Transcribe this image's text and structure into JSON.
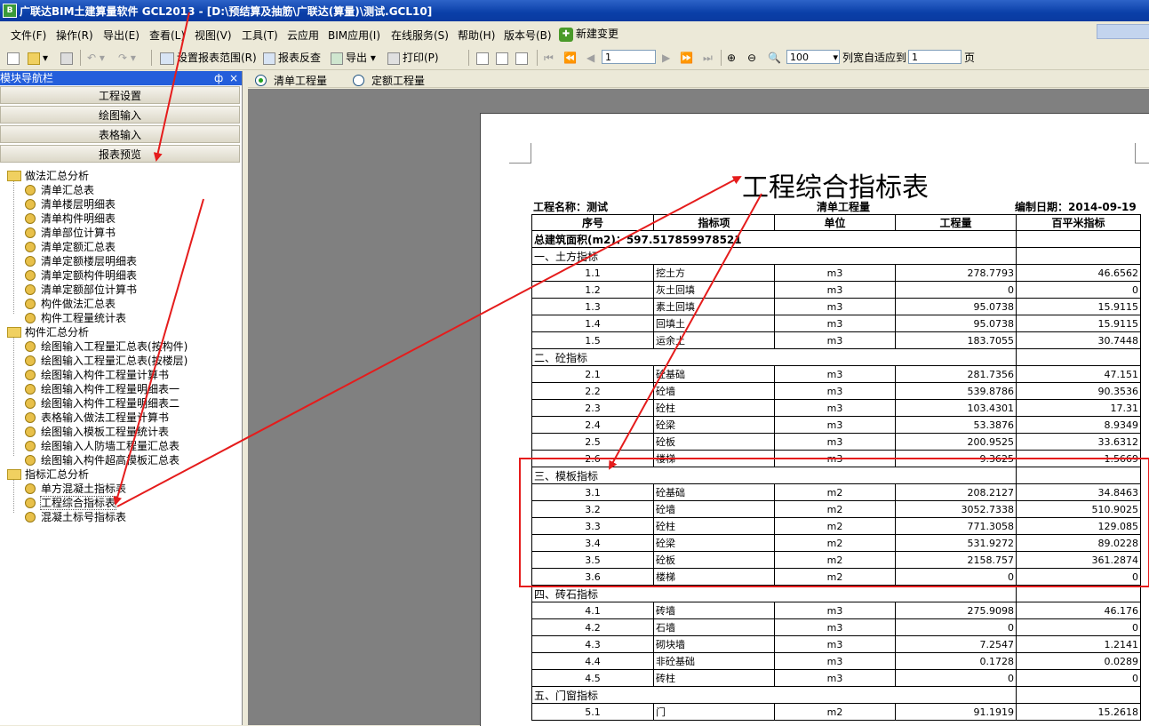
{
  "window": {
    "title": "广联达BIM土建算量软件 GCL2013 - [D:\\预结算及抽筋\\广联达(算量)\\测试.GCL10]",
    "app_icon_label": "B"
  },
  "menu": {
    "items": [
      "文件(F)",
      "操作(R)",
      "导出(E)",
      "查看(L)",
      "视图(V)",
      "工具(T)",
      "云应用",
      "BIM应用(I)",
      "在线服务(S)",
      "帮助(H)",
      "版本号(B)"
    ],
    "new_change": "新建变更"
  },
  "toolbar": {
    "set_range": "设置报表范围(R)",
    "report_check": "报表反查",
    "export": "导出",
    "print": "打印(P)",
    "page_value": "1",
    "zoom_value": "100",
    "fit_label": "列宽自适应到",
    "fit_value": "1",
    "page_unit": "页"
  },
  "nav": {
    "title": "模块导航栏",
    "pin": "ф",
    "close": "×",
    "buttons": [
      "工程设置",
      "绘图输入",
      "表格输入",
      "报表预览"
    ],
    "groups": [
      {
        "label": "做法汇总分析",
        "items": [
          "清单汇总表",
          "清单楼层明细表",
          "清单构件明细表",
          "清单部位计算书",
          "清单定额汇总表",
          "清单定额楼层明细表",
          "清单定额构件明细表",
          "清单定额部位计算书",
          "构件做法汇总表",
          "构件工程量统计表"
        ]
      },
      {
        "label": "构件汇总分析",
        "items": [
          "绘图输入工程量汇总表(按构件)",
          "绘图输入工程量汇总表(按楼层)",
          "绘图输入构件工程量计算书",
          "绘图输入构件工程量明细表一",
          "绘图输入构件工程量明细表二",
          "表格输入做法工程量计算书",
          "绘图输入模板工程量统计表",
          "绘图输入人防墙工程量汇总表",
          "绘图输入构件超高模板汇总表"
        ]
      },
      {
        "label": "指标汇总分析",
        "items": [
          "单方混凝土指标表",
          "工程综合指标表",
          "混凝土标号指标表"
        ]
      }
    ]
  },
  "view_tabs": {
    "bill": "清单工程量",
    "quota": "定额工程量"
  },
  "report": {
    "title": "工程综合指标表",
    "project": "工程名称：测试",
    "type": "清单工程量",
    "date": "编制日期：2014-09-19",
    "headers": [
      "序号",
      "指标项",
      "单位",
      "工程量",
      "百平米指标"
    ],
    "total_area": "总建筑面积(m2)：597.517859978521",
    "sections": [
      {
        "title": "一、土方指标",
        "rows": [
          [
            "1.1",
            "挖土方",
            "m3",
            "278.7793",
            "46.6562"
          ],
          [
            "1.2",
            "灰土回填",
            "m3",
            "0",
            "0"
          ],
          [
            "1.3",
            "素土回填",
            "m3",
            "95.0738",
            "15.9115"
          ],
          [
            "1.4",
            "回填土",
            "m3",
            "95.0738",
            "15.9115"
          ],
          [
            "1.5",
            "运余土",
            "m3",
            "183.7055",
            "30.7448"
          ]
        ]
      },
      {
        "title": "二、砼指标",
        "rows": [
          [
            "2.1",
            "砼基础",
            "m3",
            "281.7356",
            "47.151"
          ],
          [
            "2.2",
            "砼墙",
            "m3",
            "539.8786",
            "90.3536"
          ],
          [
            "2.3",
            "砼柱",
            "m3",
            "103.4301",
            "17.31"
          ],
          [
            "2.4",
            "砼梁",
            "m3",
            "53.3876",
            "8.9349"
          ],
          [
            "2.5",
            "砼板",
            "m3",
            "200.9525",
            "33.6312"
          ],
          [
            "2.6",
            "楼梯",
            "m3",
            "9.3625",
            "1.5669"
          ]
        ]
      },
      {
        "title": "三、模板指标",
        "rows": [
          [
            "3.1",
            "砼基础",
            "m2",
            "208.2127",
            "34.8463"
          ],
          [
            "3.2",
            "砼墙",
            "m2",
            "3052.7338",
            "510.9025"
          ],
          [
            "3.3",
            "砼柱",
            "m2",
            "771.3058",
            "129.085"
          ],
          [
            "3.4",
            "砼梁",
            "m2",
            "531.9272",
            "89.0228"
          ],
          [
            "3.5",
            "砼板",
            "m2",
            "2158.757",
            "361.2874"
          ],
          [
            "3.6",
            "楼梯",
            "m2",
            "0",
            "0"
          ]
        ]
      },
      {
        "title": "四、砖石指标",
        "rows": [
          [
            "4.1",
            "砖墙",
            "m3",
            "275.9098",
            "46.176"
          ],
          [
            "4.2",
            "石墙",
            "m3",
            "0",
            "0"
          ],
          [
            "4.3",
            "砌块墙",
            "m3",
            "7.2547",
            "1.2141"
          ],
          [
            "4.4",
            "非砼基础",
            "m3",
            "0.1728",
            "0.0289"
          ],
          [
            "4.5",
            "砖柱",
            "m3",
            "0",
            "0"
          ]
        ]
      },
      {
        "title": "五、门窗指标",
        "rows": [
          [
            "5.1",
            "门",
            "m2",
            "91.1919",
            "15.2618"
          ]
        ]
      }
    ]
  },
  "annotation_color": "#e51c1c"
}
